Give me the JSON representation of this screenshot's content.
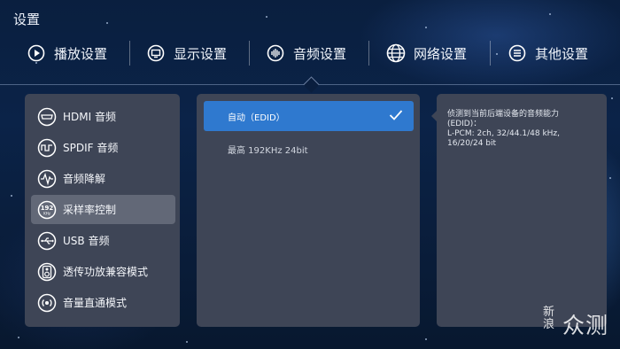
{
  "window": {
    "title": "设置"
  },
  "tabs": [
    {
      "label": "播放设置",
      "icon": "play-icon"
    },
    {
      "label": "显示设置",
      "icon": "display-icon"
    },
    {
      "label": "音频设置",
      "icon": "audio-wave-icon"
    },
    {
      "label": "网络设置",
      "icon": "globe-icon"
    },
    {
      "label": "其他设置",
      "icon": "menu-icon"
    }
  ],
  "active_tab": "音频设置",
  "sidebar": {
    "items": [
      {
        "label": "HDMI 音频",
        "icon": "hdmi-icon"
      },
      {
        "label": "SPDIF 音频",
        "icon": "spdif-icon"
      },
      {
        "label": "音频降解",
        "icon": "waveform-icon"
      },
      {
        "label": "采样率控制",
        "icon": "sample-rate-icon",
        "icon_text": "192 KHz"
      },
      {
        "label": "USB 音频",
        "icon": "usb-icon"
      },
      {
        "label": "透传功放兼容模式",
        "icon": "amplifier-icon"
      },
      {
        "label": "音量直通模式",
        "icon": "volume-passthrough-icon"
      }
    ],
    "active": "采样率控制"
  },
  "options": [
    {
      "label": "自动（EDID）",
      "selected": true
    },
    {
      "label": "最高 192KHz 24bit",
      "selected": false
    }
  ],
  "description": {
    "lines": [
      "侦测到当前后端设备的音频能力",
      "(EDID)：",
      "L-PCM: 2ch, 32/44.1/48 kHz,",
      "16/20/24 bit"
    ]
  },
  "watermark": {
    "part1": "新浪",
    "part2": "众测"
  },
  "colors": {
    "accent": "#2f79cf",
    "panel": "#3e4556",
    "active_item": "#626877"
  }
}
